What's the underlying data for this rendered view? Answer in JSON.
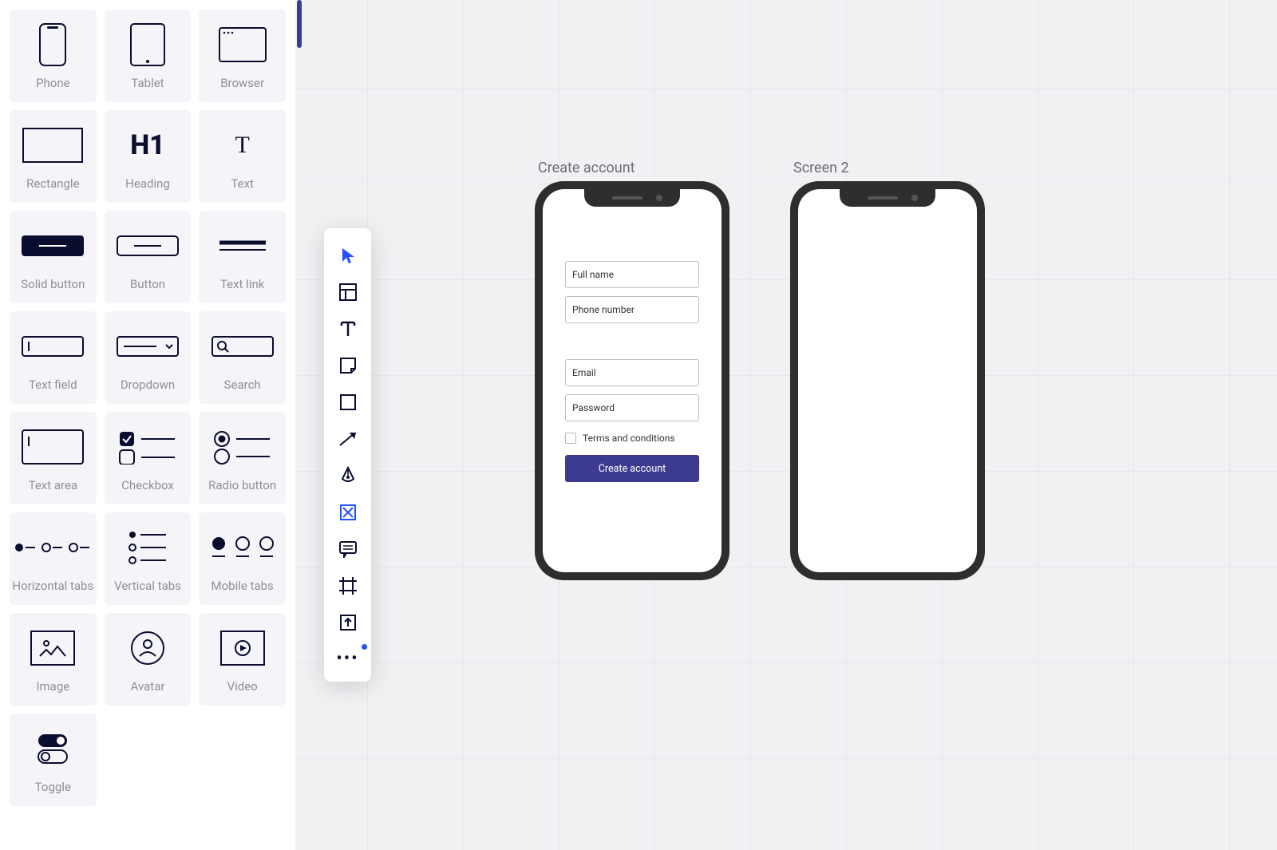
{
  "palette": {
    "items": [
      {
        "id": "phone",
        "label": "Phone"
      },
      {
        "id": "tablet",
        "label": "Tablet"
      },
      {
        "id": "browser",
        "label": "Browser"
      },
      {
        "id": "rectangle",
        "label": "Rectangle"
      },
      {
        "id": "heading",
        "label": "Heading"
      },
      {
        "id": "text",
        "label": "Text"
      },
      {
        "id": "solid-button",
        "label": "Solid button"
      },
      {
        "id": "button",
        "label": "Button"
      },
      {
        "id": "text-link",
        "label": "Text link"
      },
      {
        "id": "text-field",
        "label": "Text field"
      },
      {
        "id": "dropdown",
        "label": "Dropdown"
      },
      {
        "id": "search",
        "label": "Search"
      },
      {
        "id": "text-area",
        "label": "Text area"
      },
      {
        "id": "checkbox",
        "label": "Checkbox"
      },
      {
        "id": "radio-button",
        "label": "Radio button"
      },
      {
        "id": "horizontal-tabs",
        "label": "Horizontal tabs"
      },
      {
        "id": "vertical-tabs",
        "label": "Vertical tabs"
      },
      {
        "id": "mobile-tabs",
        "label": "Mobile tabs"
      },
      {
        "id": "image",
        "label": "Image"
      },
      {
        "id": "avatar",
        "label": "Avatar"
      },
      {
        "id": "video",
        "label": "Video"
      },
      {
        "id": "toggle",
        "label": "Toggle"
      }
    ]
  },
  "toolbar": {
    "tools": [
      {
        "id": "select",
        "name": "select-tool",
        "active": true
      },
      {
        "id": "layout",
        "name": "layout-tool",
        "active": false
      },
      {
        "id": "text",
        "name": "text-tool",
        "active": false
      },
      {
        "id": "note",
        "name": "note-tool",
        "active": false
      },
      {
        "id": "rect",
        "name": "rectangle-tool",
        "active": false
      },
      {
        "id": "arrow",
        "name": "arrow-tool",
        "active": false
      },
      {
        "id": "pen",
        "name": "pen-tool",
        "active": false
      },
      {
        "id": "icon",
        "name": "icon-tool",
        "active": true
      },
      {
        "id": "comment",
        "name": "comment-tool",
        "active": false
      },
      {
        "id": "frame",
        "name": "frame-tool",
        "active": false
      },
      {
        "id": "export",
        "name": "export-tool",
        "active": false
      }
    ]
  },
  "canvas": {
    "artboards": [
      {
        "label": "Create account",
        "form": {
          "fields": [
            {
              "placeholder": "Full name"
            },
            {
              "placeholder": "Phone number"
            }
          ],
          "fields2": [
            {
              "placeholder": "Email"
            },
            {
              "placeholder": "Password"
            }
          ],
          "checkbox_label": "Terms and conditions",
          "submit_label": "Create account"
        }
      },
      {
        "label": "Screen 2",
        "form": null
      }
    ]
  }
}
